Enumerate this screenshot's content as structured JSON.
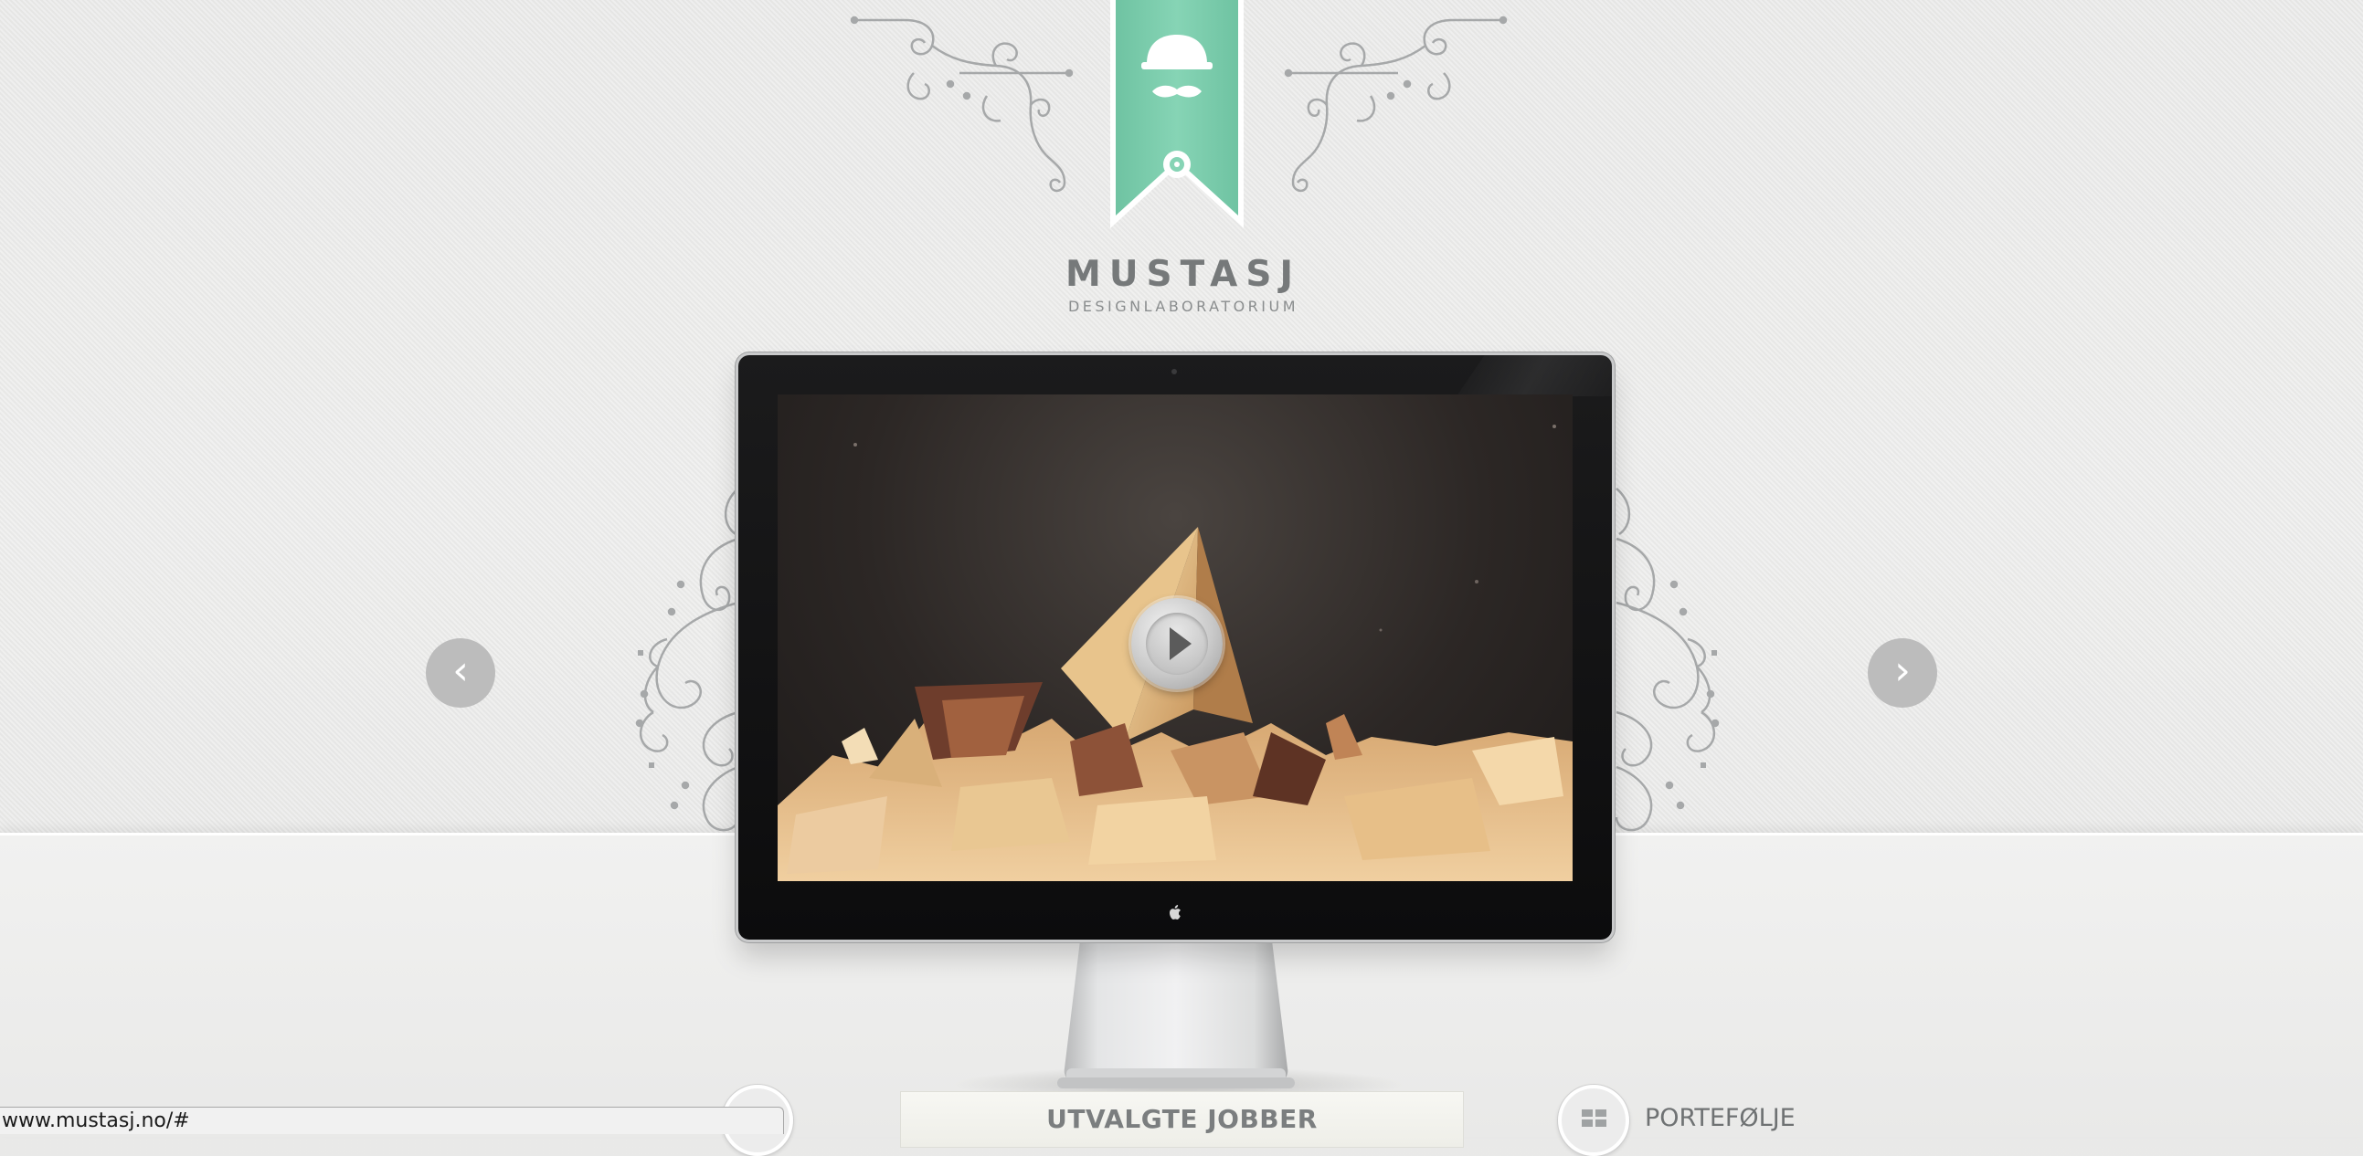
{
  "brand": {
    "name": "MUSTASJ",
    "tagline": "DESIGNLABORATORIUM"
  },
  "slider": {
    "prev_label": "‹",
    "next_label": "›"
  },
  "bottom_nav": {
    "featured_label": "UTVALGTE JOBBER",
    "portfolio_label": "PORTEFØLJE"
  },
  "status_bar": {
    "url": "www.mustasj.no/#"
  },
  "colors": {
    "ribbon": "#7fcfae",
    "background": "#ebebea",
    "text": "#76797a"
  }
}
